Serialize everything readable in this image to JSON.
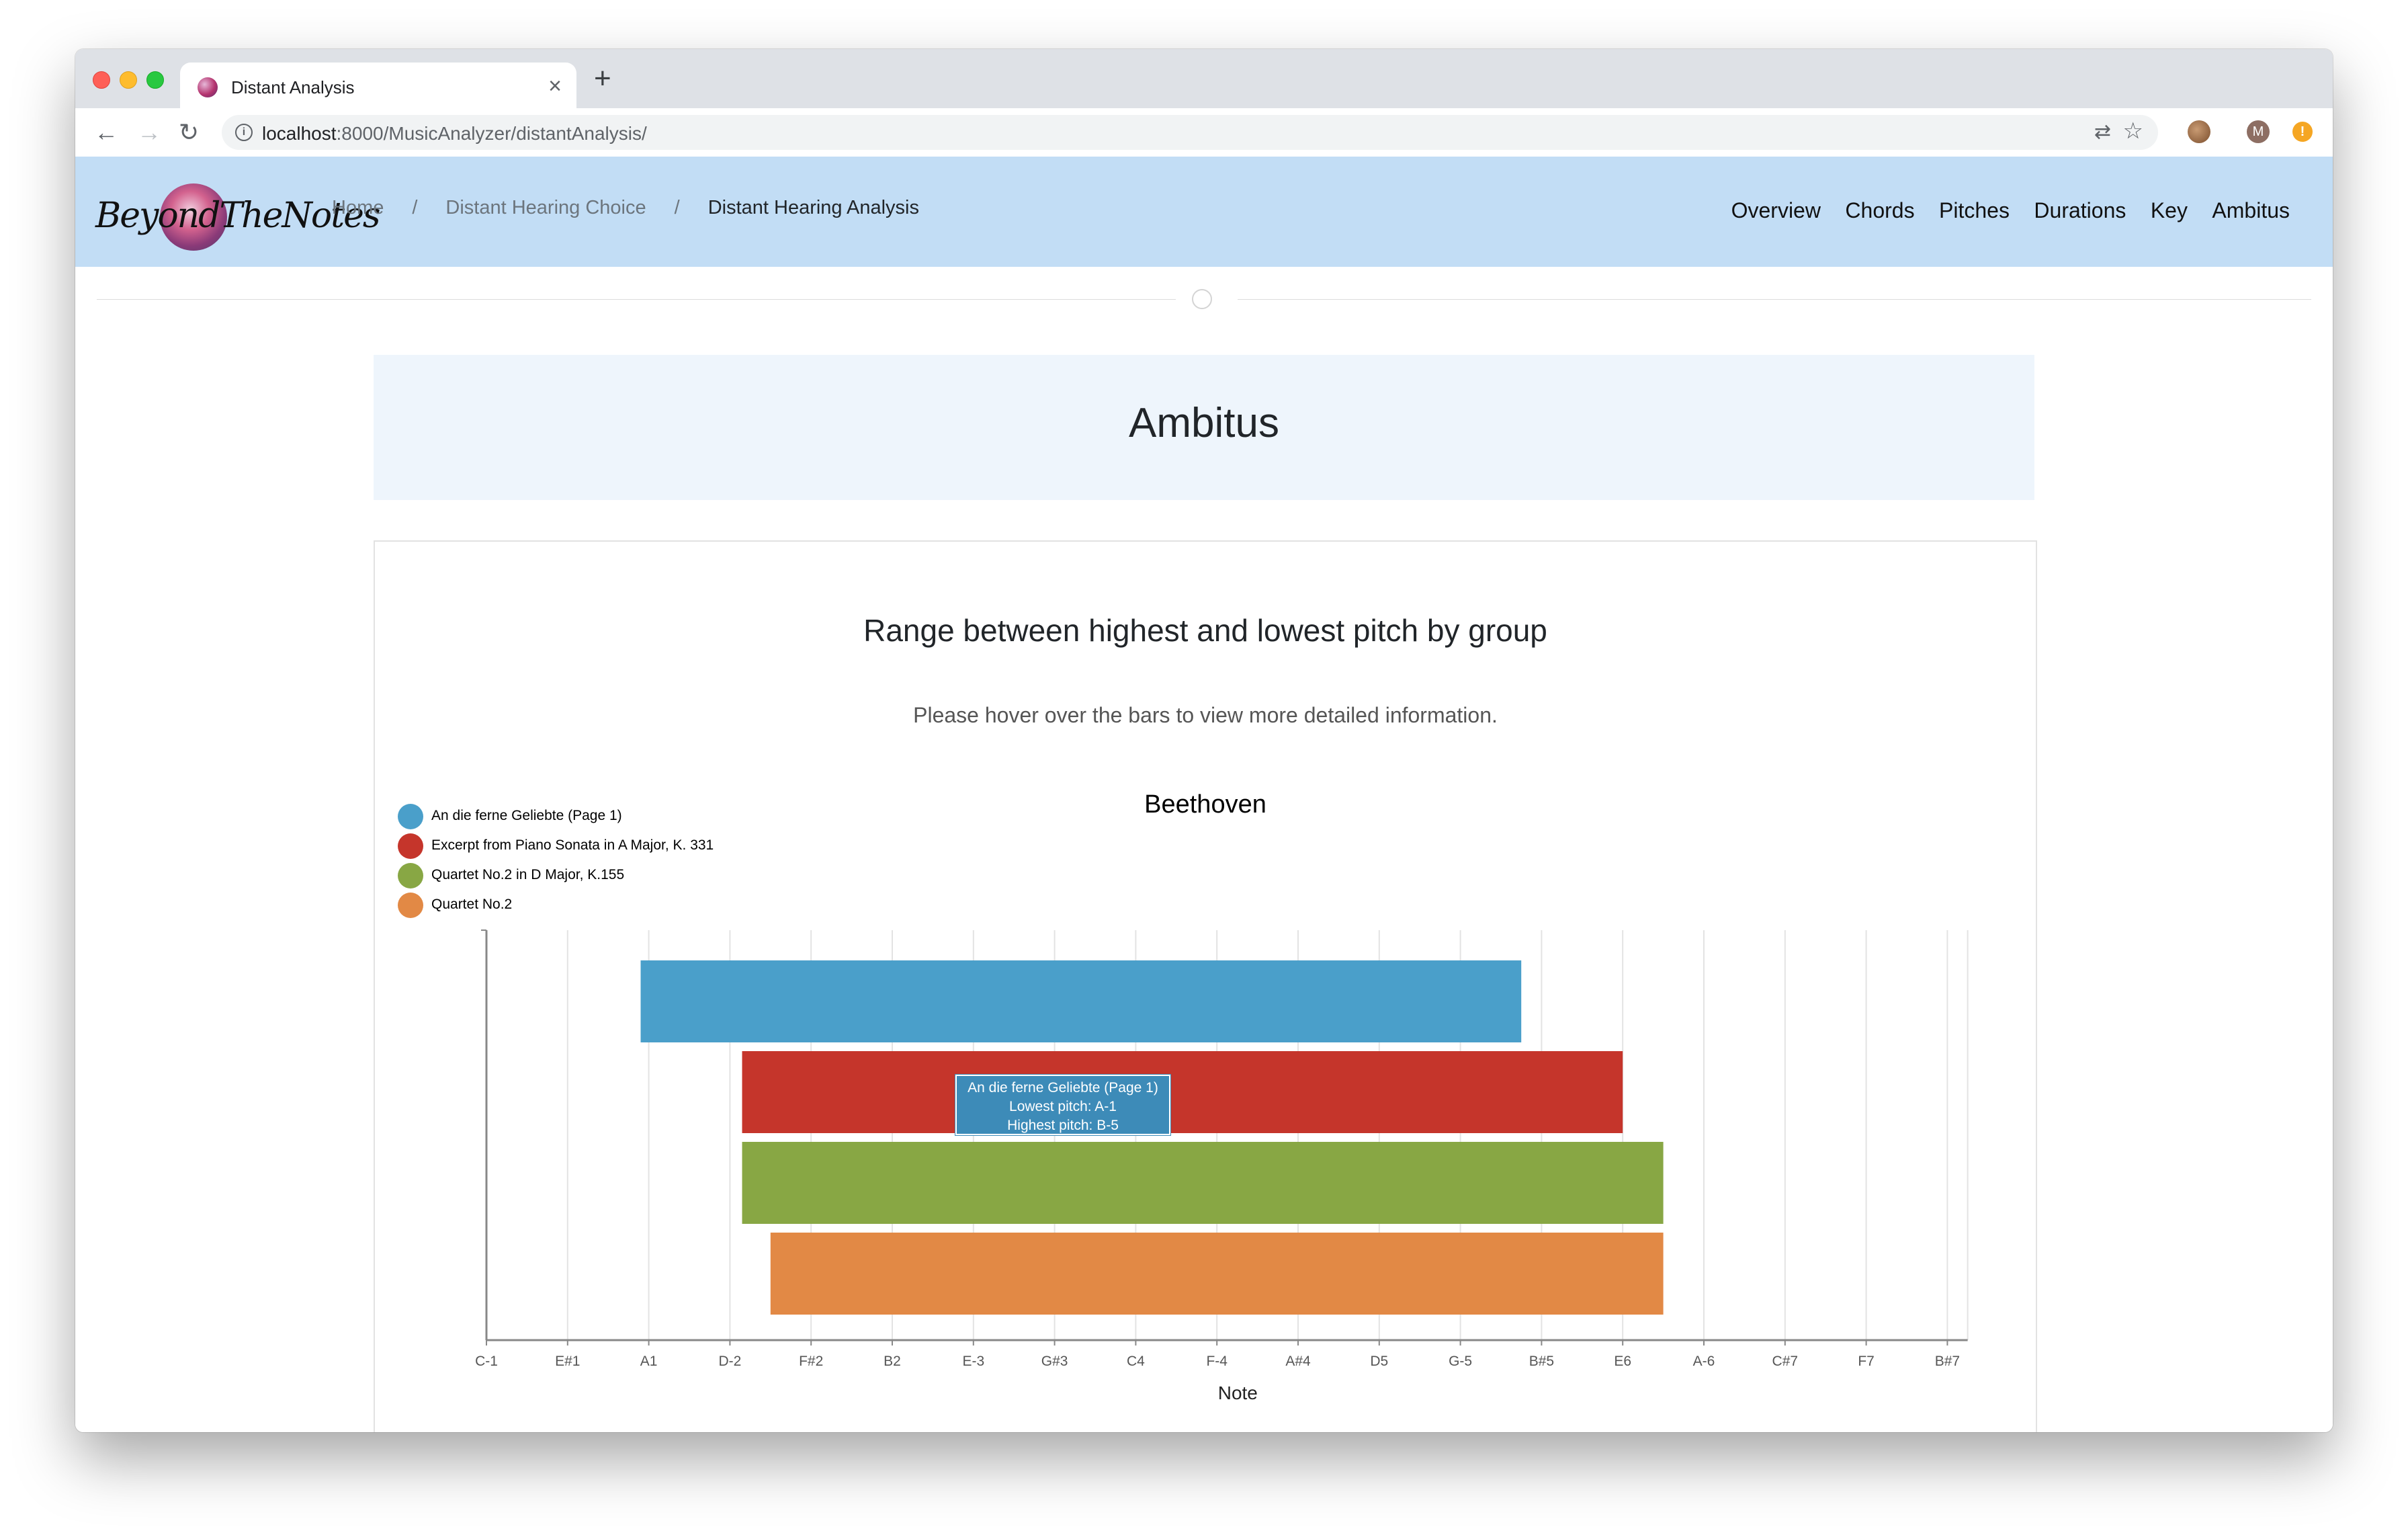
{
  "browser": {
    "tab_title": "Distant Analysis",
    "tab_close": "×",
    "new_tab": "+",
    "url_host": "localhost",
    "url_rest": ":8000/MusicAnalyzer/distantAnalysis/",
    "avatar_initial": "M",
    "alert_glyph": "!"
  },
  "navbar": {
    "brand": "BeyondTheNotes",
    "breadcrumb": [
      "Home",
      "Distant Hearing Choice",
      "Distant Hearing Analysis"
    ],
    "breadcrumb_sep": "/",
    "menu": [
      "Overview",
      "Chords",
      "Pitches",
      "Durations",
      "Key",
      "Ambitus"
    ]
  },
  "section": {
    "title": "Ambitus"
  },
  "card": {
    "title": "Range between highest and lowest pitch by group",
    "hint": "Please hover over the bars to view more detailed information."
  },
  "tooltip": {
    "title": "An die ferne Geliebte (Page 1)",
    "lowest": "Lowest pitch: A-1",
    "highest": "Highest pitch: B-5"
  },
  "chart_data": {
    "type": "bar",
    "orientation": "horizontal-range",
    "title": "Beethoven",
    "xlabel": "Note",
    "ylabel": "",
    "x_ticks": [
      "C-1",
      "E#1",
      "A1",
      "D-2",
      "F#2",
      "B2",
      "E-3",
      "G#3",
      "C4",
      "F-4",
      "A#4",
      "D5",
      "G-5",
      "B#5",
      "E6",
      "A-6",
      "C#7",
      "F7",
      "B#7"
    ],
    "x_range": [
      0,
      18.25
    ],
    "legend_position": "top-left",
    "grid": true,
    "series": [
      {
        "name": "An die ferne Geliebte (Page 1)",
        "color": "#4a9fca",
        "start": 1.9,
        "end": 12.75
      },
      {
        "name": "Excerpt from Piano Sonata in A Major, K. 331",
        "color": "#c5352b",
        "start": 3.15,
        "end": 14.0
      },
      {
        "name": "Quartet No.2 in D Major, K.155",
        "color": "#88a744",
        "start": 3.15,
        "end": 14.5
      },
      {
        "name": "Quartet No.2",
        "color": "#e28945",
        "start": 3.5,
        "end": 14.5
      }
    ]
  }
}
